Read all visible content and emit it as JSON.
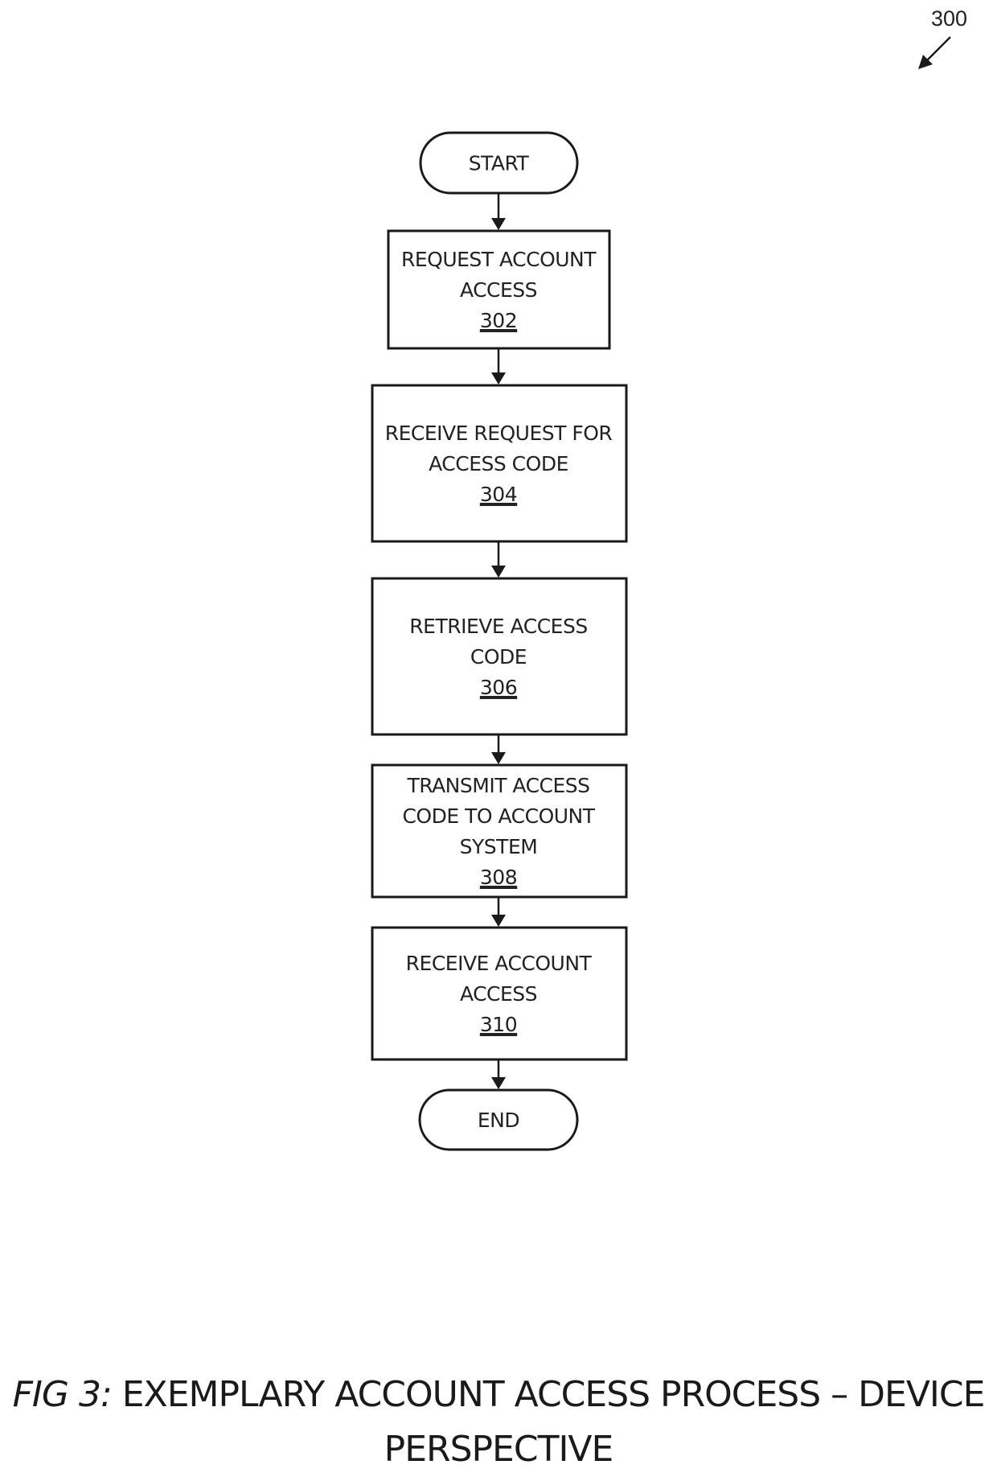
{
  "figure": {
    "reference_number": "300",
    "caption_prefix": "FIG 3:",
    "caption_text": " EXEMPLARY ACCOUNT ACCESS PROCESS – DEVICE PERSPECTIVE"
  },
  "flowchart": {
    "nodes": [
      {
        "id": "start",
        "type": "terminal",
        "lines": [
          "START"
        ],
        "ref": ""
      },
      {
        "id": "302",
        "type": "process",
        "lines": [
          "REQUEST ACCOUNT",
          "ACCESS"
        ],
        "ref": "302"
      },
      {
        "id": "304",
        "type": "process",
        "lines": [
          "RECEIVE REQUEST FOR",
          "ACCESS CODE"
        ],
        "ref": "304"
      },
      {
        "id": "306",
        "type": "process",
        "lines": [
          "RETRIEVE ACCESS",
          "CODE"
        ],
        "ref": "306"
      },
      {
        "id": "308",
        "type": "process",
        "lines": [
          "TRANSMIT ACCESS",
          "CODE TO ACCOUNT",
          "SYSTEM"
        ],
        "ref": "308"
      },
      {
        "id": "310",
        "type": "process",
        "lines": [
          "RECEIVE ACCOUNT",
          "ACCESS"
        ],
        "ref": "310"
      },
      {
        "id": "end",
        "type": "terminal",
        "lines": [
          "END"
        ],
        "ref": ""
      }
    ],
    "edges": [
      {
        "from": "start",
        "to": "302"
      },
      {
        "from": "302",
        "to": "304"
      },
      {
        "from": "304",
        "to": "306"
      },
      {
        "from": "306",
        "to": "308"
      },
      {
        "from": "308",
        "to": "310"
      },
      {
        "from": "310",
        "to": "end"
      }
    ]
  }
}
